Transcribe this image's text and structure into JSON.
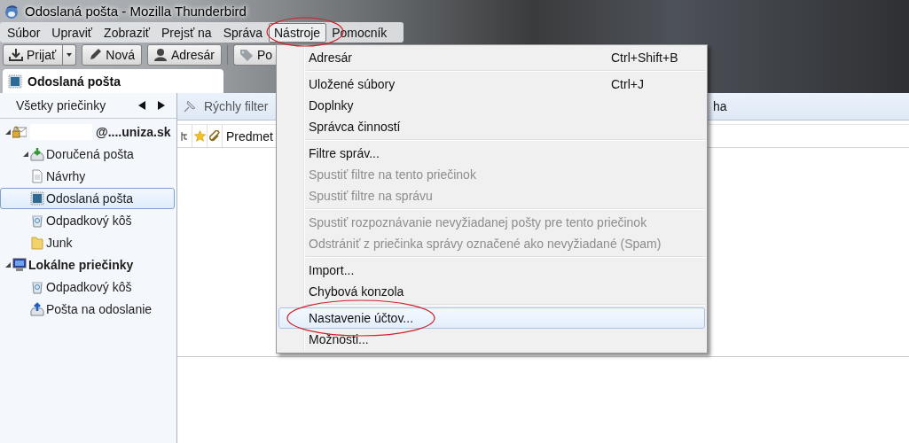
{
  "window": {
    "title": "Odoslaná pošta - Mozilla Thunderbird"
  },
  "menubar": [
    {
      "label": "Súbor",
      "selected": false
    },
    {
      "label": "Upraviť",
      "selected": false
    },
    {
      "label": "Zobraziť",
      "selected": false
    },
    {
      "label": "Prejsť na",
      "selected": false
    },
    {
      "label": "Správa",
      "selected": false
    },
    {
      "label": "Nástroje",
      "selected": true
    },
    {
      "label": "Pomocník",
      "selected": false
    }
  ],
  "toolbar": [
    {
      "label": "Prijať",
      "kind": "receive"
    },
    {
      "label": "Nová",
      "kind": "write"
    },
    {
      "label": "Adresár",
      "kind": "contacts"
    },
    {
      "label": "Po",
      "kind": "tag"
    }
  ],
  "tabs": [
    {
      "label": "Odoslaná pošta",
      "selected": true
    }
  ],
  "folder_pane": {
    "header": "Všetky priečinky",
    "tree": [
      {
        "label": "@....uniza.sk",
        "kind": "account",
        "expanded": true,
        "selected": false,
        "children": [
          {
            "label": "Doručená pošta",
            "kind": "inbox",
            "expanded": true,
            "selected": false
          },
          {
            "label": "Návrhy",
            "kind": "drafts",
            "selected": false
          },
          {
            "label": "Odoslaná pošta",
            "kind": "sent",
            "selected": true
          },
          {
            "label": "Odpadkový kôš",
            "kind": "trash",
            "selected": false
          },
          {
            "label": "Junk",
            "kind": "folder",
            "selected": false
          }
        ]
      },
      {
        "label": "Lokálne priečinky",
        "kind": "local",
        "expanded": true,
        "selected": false,
        "children": [
          {
            "label": "Odpadkový kôš",
            "kind": "trash",
            "selected": false
          },
          {
            "label": "Pošta na odoslanie",
            "kind": "outbox",
            "selected": false
          }
        ]
      }
    ]
  },
  "filter_bar": {
    "label": "Rýchly filter",
    "text_2": "ha"
  },
  "message_list": {
    "columns": [
      "Predmet"
    ]
  },
  "menu": {
    "items": [
      {
        "kind": "item",
        "label": "Adresár",
        "shortcut": "Ctrl+Shift+B",
        "disabled": false,
        "selected": false
      },
      {
        "kind": "separator"
      },
      {
        "kind": "item",
        "label": "Uložené súbory",
        "shortcut": "Ctrl+J",
        "disabled": false,
        "selected": false
      },
      {
        "kind": "item",
        "label": "Doplnky",
        "disabled": false,
        "selected": false
      },
      {
        "kind": "item",
        "label": "Správca činností",
        "disabled": false,
        "selected": false
      },
      {
        "kind": "separator"
      },
      {
        "kind": "item",
        "label": "Filtre správ...",
        "disabled": false,
        "selected": false
      },
      {
        "kind": "item",
        "label": "Spustiť filtre na tento priečinok",
        "disabled": true,
        "selected": false
      },
      {
        "kind": "item",
        "label": "Spustiť filtre na správu",
        "disabled": true,
        "selected": false
      },
      {
        "kind": "separator"
      },
      {
        "kind": "item",
        "label": "Spustiť rozpoznávanie nevyžiadanej pošty pre tento priečinok",
        "disabled": true,
        "selected": false
      },
      {
        "kind": "item",
        "label": "Odstrániť z priečinka správy označené ako nevyžiadané (Spam)",
        "disabled": true,
        "selected": false
      },
      {
        "kind": "separator"
      },
      {
        "kind": "item",
        "label": "Import...",
        "disabled": false,
        "selected": false
      },
      {
        "kind": "item",
        "label": "Chybová konzola",
        "disabled": false,
        "selected": false
      },
      {
        "kind": "separator"
      },
      {
        "kind": "item",
        "label": "Nastavenie účtov...",
        "disabled": false,
        "selected": true
      },
      {
        "kind": "item",
        "label": "Možnosti...",
        "disabled": false,
        "selected": false
      }
    ]
  }
}
